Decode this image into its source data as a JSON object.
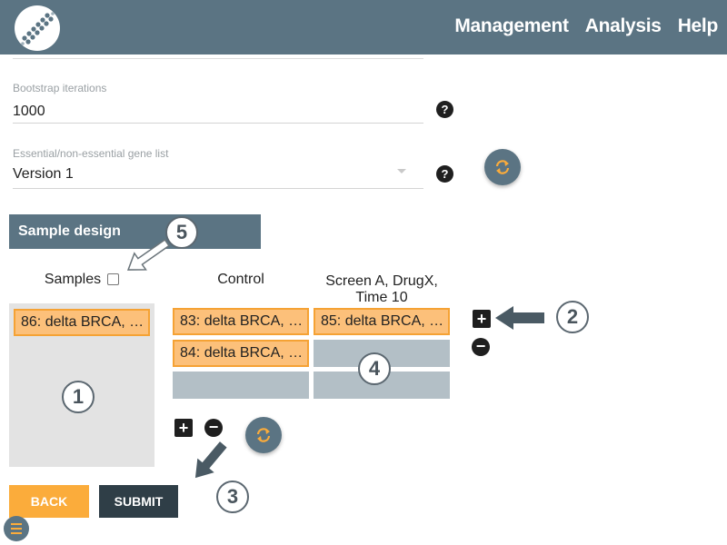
{
  "header": {
    "nav": [
      "Management",
      "Analysis",
      "Help"
    ],
    "logo_icon": "dna-logo-icon"
  },
  "bootstrap": {
    "label": "Bootstrap iterations",
    "value": "1000"
  },
  "gene_list": {
    "label": "Essential/non-essential gene list",
    "value": "Version 1"
  },
  "help_glyph": "?",
  "sample_design": {
    "title": "Sample design",
    "columns": {
      "samples": "Samples",
      "control": "Control",
      "screen": "Screen A, DrugX,",
      "screen_line2": "Time 10"
    },
    "samples_list": [
      "86: delta BRCA, …"
    ],
    "control_list": [
      "83: delta BRCA, …",
      "84: delta BRCA, …"
    ],
    "screen_list": [
      "85: delta BRCA, …"
    ]
  },
  "buttons": {
    "back": "BACK",
    "submit": "SUBMIT",
    "plus": "+",
    "minus": "−"
  },
  "callouts": [
    "1",
    "2",
    "3",
    "4",
    "5"
  ],
  "colors": {
    "header": "#5b7483",
    "chip": "#fcc07a",
    "chip_border": "#f5a234",
    "back": "#fbac3b",
    "submit": "#2f3e47"
  }
}
